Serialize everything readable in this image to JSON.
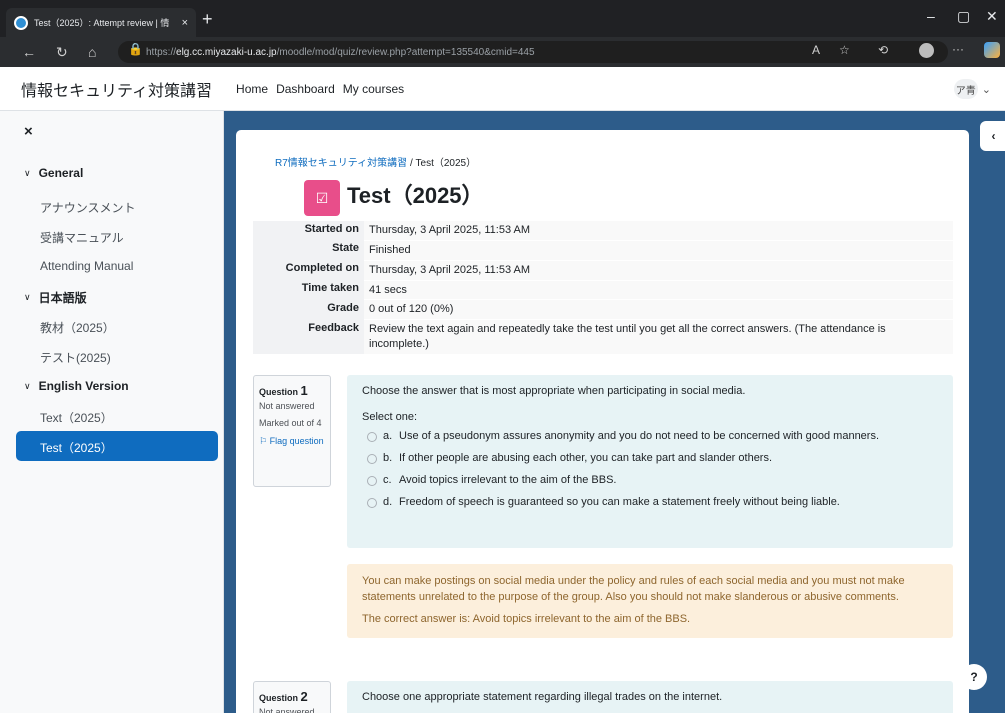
{
  "browser": {
    "tab_title": "Test（2025）: Attempt review | 情",
    "tab_close": "×",
    "new_tab": "+",
    "url_prefix": "https://",
    "url_host": "elg.cc.miyazaki-u.ac.jp",
    "url_path": "/moodle/mod/quiz/review.php?attempt=135540&cmid=445"
  },
  "site": {
    "brand": "情報セキュリティ対策講習",
    "nav": [
      "Home",
      "Dashboard",
      "My courses"
    ],
    "user_initials": "ア青"
  },
  "drawer": {
    "close": "×",
    "sections": [
      {
        "title": "General",
        "items": [
          "アナウンスメント",
          "受講マニュアル",
          "Attending Manual"
        ]
      },
      {
        "title": "日本語版",
        "items": [
          "教材（2025）",
          "テスト(2025)"
        ]
      },
      {
        "title": "English Version",
        "items": [
          "Text（2025）",
          "Test（2025）"
        ]
      }
    ]
  },
  "main": {
    "breadcrumb": {
      "course": "R7情報セキュリティ対策講習",
      "sep": "/",
      "current": "Test（2025）"
    },
    "title": "Test（2025）",
    "summary": [
      {
        "label": "Started on",
        "value": "Thursday, 3 April 2025, 11:53 AM"
      },
      {
        "label": "State",
        "value": "Finished"
      },
      {
        "label": "Completed on",
        "value": "Thursday, 3 April 2025, 11:53 AM"
      },
      {
        "label": "Time taken",
        "value": "41 secs"
      },
      {
        "label": "Grade",
        "value": "0 out of 120 (0%)"
      },
      {
        "label": "Feedback",
        "value": "Review the text again and repeatedly take the test until you get all the correct answers. (The attendance is incomplete.)"
      }
    ],
    "q1": {
      "label": "Question",
      "number": "1",
      "state": "Not answered",
      "marks": "Marked out of 4",
      "flag": "Flag question",
      "text": "Choose the answer that is most appropriate when participating in social media.",
      "prompt": "Select one:",
      "options": [
        {
          "letter": "a.",
          "text": "Use of a pseudonym assures anonymity and you do not need to be concerned with good manners."
        },
        {
          "letter": "b.",
          "text": "If other people are abusing each other, you can take part and slander others."
        },
        {
          "letter": "c.",
          "text": "Avoid topics irrelevant to the aim of the BBS."
        },
        {
          "letter": "d.",
          "text": "Freedom of speech is guaranteed so you can make a statement freely without being liable."
        }
      ],
      "feedback": "You can make postings on social media under the policy and rules of each social media and you must not make statements unrelated to the purpose of the group. Also you should not make slanderous or abusive comments.",
      "correct": "The correct answer is: Avoid topics irrelevant to the aim of the BBS."
    },
    "q2": {
      "label": "Question",
      "number": "2",
      "state": "Not answered",
      "text": "Choose one appropriate statement regarding illegal trades on the internet."
    }
  },
  "help": "?"
}
